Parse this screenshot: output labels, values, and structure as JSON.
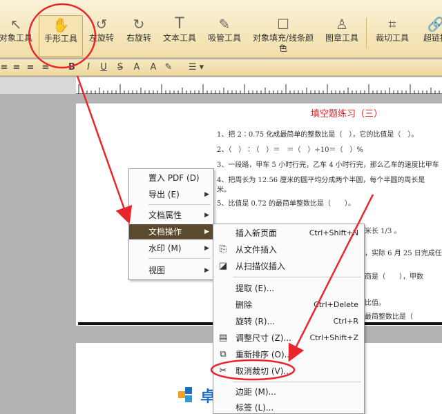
{
  "toolbar": {
    "tools": [
      {
        "label": "对象工具",
        "icon": "cursor-icon"
      },
      {
        "label": "手形工具",
        "icon": "hand-icon"
      },
      {
        "label": "左旋转",
        "icon": "rotate-left-icon"
      },
      {
        "label": "右旋转",
        "icon": "rotate-right-icon"
      },
      {
        "label": "文本工具",
        "icon": "text-tool-icon"
      },
      {
        "label": "吸管工具",
        "icon": "eyedropper-icon"
      },
      {
        "label": "对象填充/线条颜色",
        "icon": "fill-color-icon"
      },
      {
        "label": "图章工具",
        "icon": "stamp-icon"
      },
      {
        "label": "裁切工具",
        "icon": "crop-icon"
      },
      {
        "label": "超链接",
        "icon": "link-icon"
      }
    ],
    "format_buttons": [
      "B",
      "I",
      "U",
      "S",
      "A",
      "A"
    ]
  },
  "document": {
    "title": "填空题练习（三）",
    "lines": [
      "1、把 2∶0.75 化成最简单的整数比是（　），它的比值是（　）。",
      "2、（　）∶（　）＝　＝（　）÷10＝（　）%",
      "3、一段路，甲车 5 小时行完，乙车 4 小时行完，那么乙车的速度比甲车",
      "4、把周长为 12.56 厘米的圆平均分成两个半圆，每个半圆的周长是",
      "米。",
      "5、比值是 0.72 的最简单整数比是（　　）。",
      "米长 1/3 。",
      "，实际 6 月 25 日完成任",
      "商是（　　），甲数",
      "比值。",
      "最简整数比是（"
    ],
    "page2_logo_text": "卓"
  },
  "main_menu": {
    "items": [
      {
        "label": "置入 PDF (D)",
        "submenu": false
      },
      {
        "label": "导出 (E)",
        "submenu": true
      },
      {
        "label": "文档属性",
        "submenu": true
      },
      {
        "label": "文档操作",
        "submenu": true,
        "highlighted": true
      },
      {
        "label": "水印 (M)",
        "submenu": true
      },
      {
        "label": "视图",
        "submenu": true
      }
    ]
  },
  "submenu": {
    "items": [
      {
        "label": "插入新页面",
        "shortcut": "Ctrl+Shift+N",
        "icon": ""
      },
      {
        "label": "从文件插入",
        "shortcut": "",
        "icon": "insert-file-icon"
      },
      {
        "label": "从扫描仪插入",
        "shortcut": "",
        "icon": "scanner-icon"
      },
      {
        "label": "提取 (E)...",
        "shortcut": "",
        "icon": ""
      },
      {
        "label": "删除",
        "shortcut": "Ctrl+Delete",
        "icon": ""
      },
      {
        "label": "旋转 (R)...",
        "shortcut": "Ctrl+R",
        "icon": ""
      },
      {
        "label": "调整尺寸 (Z)...",
        "shortcut": "Ctrl+Shift+Z",
        "icon": "resize-icon"
      },
      {
        "label": "重新排序 (O)...",
        "shortcut": "",
        "icon": "reorder-icon"
      },
      {
        "label": "取消裁切 (V)...",
        "shortcut": "",
        "icon": "uncrop-icon"
      },
      {
        "label": "边距 (M)...",
        "shortcut": "",
        "icon": ""
      },
      {
        "label": "标签 (L)...",
        "shortcut": "",
        "icon": ""
      }
    ]
  },
  "colors": {
    "annotation": "#e8262b",
    "menu_highlight": "#5a4a2e"
  }
}
